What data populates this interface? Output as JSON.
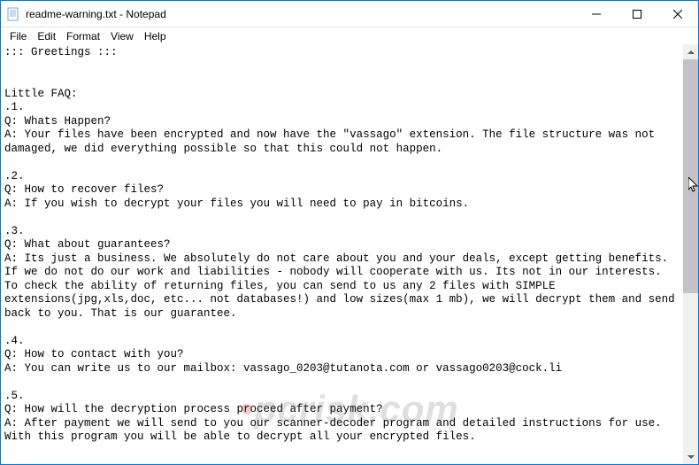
{
  "window": {
    "title": "readme-warning.txt - Notepad"
  },
  "menubar": {
    "items": [
      "File",
      "Edit",
      "Format",
      "View",
      "Help"
    ]
  },
  "content": {
    "text": "::: Greetings :::\n\n\nLittle FAQ:\n.1.\nQ: Whats Happen?\nA: Your files have been encrypted and now have the \"vassago\" extension. The file structure was not damaged, we did everything possible so that this could not happen.\n\n.2.\nQ: How to recover files?\nA: If you wish to decrypt your files you will need to pay in bitcoins.\n\n.3.\nQ: What about guarantees?\nA: Its just a business. We absolutely do not care about you and your deals, except getting benefits. If we do not do our work and liabilities - nobody will cooperate with us. Its not in our interests.\nTo check the ability of returning files, you can send to us any 2 files with SIMPLE extensions(jpg,xls,doc, etc... not databases!) and low sizes(max 1 mb), we will decrypt them and send back to you. That is our guarantee.\n\n.4.\nQ: How to contact with you?\nA: You can write us to our mailbox: vassago_0203@tutanota.com or vassago0203@cock.li\n\n.5.\nQ: How will the decryption process proceed after payment?\nA: After payment we will send to you our scanner-decoder program and detailed instructions for use. With this program you will be able to decrypt all your encrypted files.\n"
  },
  "watermark": {
    "prefix": "•",
    "text": "pcrisk.com"
  }
}
